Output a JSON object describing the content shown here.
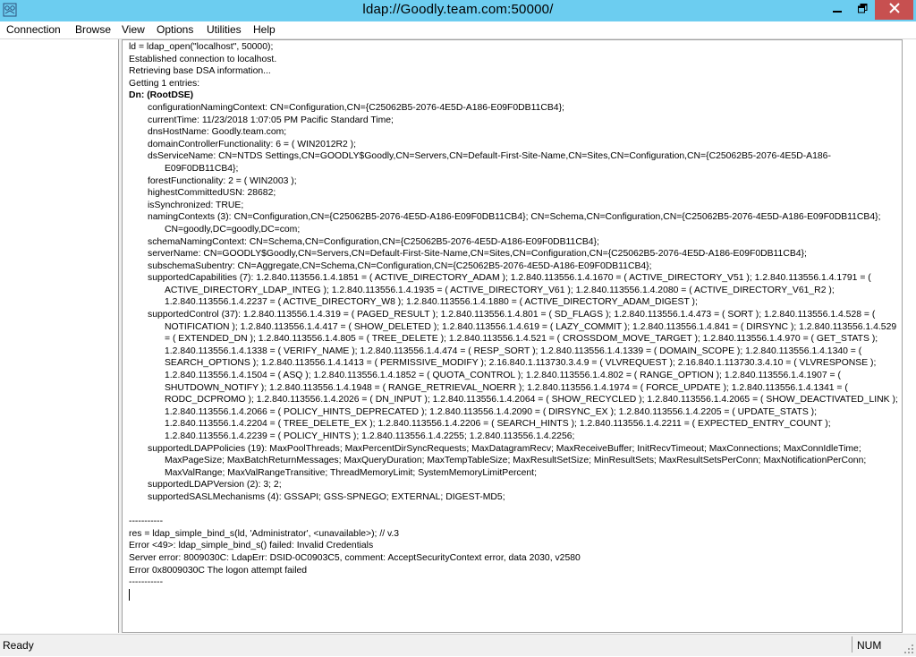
{
  "window": {
    "title": "ldap://Goodly.team.com:50000/",
    "app_icon": "ldp-app-icon",
    "controls": [
      "minimize-icon",
      "maximize-icon",
      "close-icon"
    ],
    "close_color": "#c75050",
    "titlebar_color": "#6ccdf0"
  },
  "menu": [
    "Connection",
    "Browse",
    "View",
    "Options",
    "Utilities",
    "Help"
  ],
  "output": {
    "lines": [
      {
        "text": "ld = ldap_open(\"localhost\", 50000);",
        "indent": 0
      },
      {
        "text": "Established connection to localhost.",
        "indent": 0
      },
      {
        "text": "Retrieving base DSA information...",
        "indent": 0
      },
      {
        "text": "Getting 1 entries:",
        "indent": 0
      },
      {
        "text": "Dn: (RootDSE)",
        "indent": 0,
        "bold": true
      },
      {
        "text": "configurationNamingContext: CN=Configuration,CN={C25062B5-2076-4E5D-A186-E09F0DB11CB4};",
        "indent": 1
      },
      {
        "text": "currentTime: 11/23/2018 1:07:05 PM Pacific Standard Time;",
        "indent": 1
      },
      {
        "text": "dnsHostName: Goodly.team.com;",
        "indent": 1
      },
      {
        "text": "domainControllerFunctionality: 6 = ( WIN2012R2 );",
        "indent": 1
      },
      {
        "text": "dsServiceName: CN=NTDS Settings,CN=GOODLY$Goodly,CN=Servers,CN=Default-First-Site-Name,CN=Sites,CN=Configuration,CN={C25062B5-2076-4E5D-A186-",
        "indent": 1
      },
      {
        "text": "E09F0DB11CB4};",
        "indent": 2
      },
      {
        "text": "forestFunctionality: 2 = ( WIN2003 );",
        "indent": 1
      },
      {
        "text": "highestCommittedUSN: 28682;",
        "indent": 1
      },
      {
        "text": "isSynchronized: TRUE;",
        "indent": 1
      },
      {
        "text": "namingContexts (3): CN=Configuration,CN={C25062B5-2076-4E5D-A186-E09F0DB11CB4}; CN=Schema,CN=Configuration,CN={C25062B5-2076-4E5D-A186-E09F0DB11CB4};",
        "indent": 1
      },
      {
        "text": "CN=goodly,DC=goodly,DC=com;",
        "indent": 2
      },
      {
        "text": "schemaNamingContext: CN=Schema,CN=Configuration,CN={C25062B5-2076-4E5D-A186-E09F0DB11CB4};",
        "indent": 1
      },
      {
        "text": "serverName: CN=GOODLY$Goodly,CN=Servers,CN=Default-First-Site-Name,CN=Sites,CN=Configuration,CN={C25062B5-2076-4E5D-A186-E09F0DB11CB4};",
        "indent": 1
      },
      {
        "text": "subschemaSubentry: CN=Aggregate,CN=Schema,CN=Configuration,CN={C25062B5-2076-4E5D-A186-E09F0DB11CB4};",
        "indent": 1
      },
      {
        "text": "supportedCapabilities (7): 1.2.840.113556.1.4.1851 = ( ACTIVE_DIRECTORY_ADAM ); 1.2.840.113556.1.4.1670 = ( ACTIVE_DIRECTORY_V51 ); 1.2.840.113556.1.4.1791 = (",
        "indent": 1
      },
      {
        "text": "ACTIVE_DIRECTORY_LDAP_INTEG ); 1.2.840.113556.1.4.1935 = ( ACTIVE_DIRECTORY_V61 ); 1.2.840.113556.1.4.2080 = ( ACTIVE_DIRECTORY_V61_R2 );",
        "indent": 2
      },
      {
        "text": "1.2.840.113556.1.4.2237 = ( ACTIVE_DIRECTORY_W8 ); 1.2.840.113556.1.4.1880 = ( ACTIVE_DIRECTORY_ADAM_DIGEST );",
        "indent": 2
      },
      {
        "text": "supportedControl (37): 1.2.840.113556.1.4.319 = ( PAGED_RESULT ); 1.2.840.113556.1.4.801 = ( SD_FLAGS ); 1.2.840.113556.1.4.473 = ( SORT ); 1.2.840.113556.1.4.528 = (",
        "indent": 1
      },
      {
        "text": "NOTIFICATION ); 1.2.840.113556.1.4.417 = ( SHOW_DELETED ); 1.2.840.113556.1.4.619 = ( LAZY_COMMIT ); 1.2.840.113556.1.4.841 = ( DIRSYNC ); 1.2.840.113556.1.4.529",
        "indent": 2
      },
      {
        "text": "= ( EXTENDED_DN ); 1.2.840.113556.1.4.805 = ( TREE_DELETE ); 1.2.840.113556.1.4.521 = ( CROSSDOM_MOVE_TARGET ); 1.2.840.113556.1.4.970 = ( GET_STATS );",
        "indent": 2
      },
      {
        "text": "1.2.840.113556.1.4.1338 = ( VERIFY_NAME ); 1.2.840.113556.1.4.474 = ( RESP_SORT ); 1.2.840.113556.1.4.1339 = ( DOMAIN_SCOPE ); 1.2.840.113556.1.4.1340 = (",
        "indent": 2
      },
      {
        "text": "SEARCH_OPTIONS ); 1.2.840.113556.1.4.1413 = ( PERMISSIVE_MODIFY ); 2.16.840.1.113730.3.4.9 = ( VLVREQUEST ); 2.16.840.1.113730.3.4.10 = ( VLVRESPONSE );",
        "indent": 2
      },
      {
        "text": "1.2.840.113556.1.4.1504 = ( ASQ ); 1.2.840.113556.1.4.1852 = ( QUOTA_CONTROL ); 1.2.840.113556.1.4.802 = ( RANGE_OPTION ); 1.2.840.113556.1.4.1907 = (",
        "indent": 2
      },
      {
        "text": "SHUTDOWN_NOTIFY ); 1.2.840.113556.1.4.1948 = ( RANGE_RETRIEVAL_NOERR ); 1.2.840.113556.1.4.1974 = ( FORCE_UPDATE ); 1.2.840.113556.1.4.1341 = (",
        "indent": 2
      },
      {
        "text": "RODC_DCPROMO ); 1.2.840.113556.1.4.2026 = ( DN_INPUT ); 1.2.840.113556.1.4.2064 = ( SHOW_RECYCLED ); 1.2.840.113556.1.4.2065 = ( SHOW_DEACTIVATED_LINK );",
        "indent": 2
      },
      {
        "text": "1.2.840.113556.1.4.2066 = ( POLICY_HINTS_DEPRECATED ); 1.2.840.113556.1.4.2090 = ( DIRSYNC_EX ); 1.2.840.113556.1.4.2205 = ( UPDATE_STATS );",
        "indent": 2
      },
      {
        "text": "1.2.840.113556.1.4.2204 = ( TREE_DELETE_EX ); 1.2.840.113556.1.4.2206 = ( SEARCH_HINTS ); 1.2.840.113556.1.4.2211 = ( EXPECTED_ENTRY_COUNT );",
        "indent": 2
      },
      {
        "text": "1.2.840.113556.1.4.2239 = ( POLICY_HINTS ); 1.2.840.113556.1.4.2255; 1.2.840.113556.1.4.2256;",
        "indent": 2
      },
      {
        "text": "supportedLDAPPolicies (19): MaxPoolThreads; MaxPercentDirSyncRequests; MaxDatagramRecv; MaxReceiveBuffer; InitRecvTimeout; MaxConnections; MaxConnIdleTime;",
        "indent": 1
      },
      {
        "text": "MaxPageSize; MaxBatchReturnMessages; MaxQueryDuration; MaxTempTableSize; MaxResultSetSize; MinResultSets; MaxResultSetsPerConn; MaxNotificationPerConn;",
        "indent": 2
      },
      {
        "text": "MaxValRange; MaxValRangeTransitive; ThreadMemoryLimit; SystemMemoryLimitPercent;",
        "indent": 2
      },
      {
        "text": "supportedLDAPVersion (2): 3; 2;",
        "indent": 1
      },
      {
        "text": "supportedSASLMechanisms (4): GSSAPI; GSS-SPNEGO; EXTERNAL; DIGEST-MD5;",
        "indent": 1
      },
      {
        "text": "",
        "indent": 0
      },
      {
        "text": "-----------",
        "indent": 0
      },
      {
        "text": "res = ldap_simple_bind_s(ld, 'Administrator', <unavailable>); // v.3",
        "indent": 0
      },
      {
        "text": "Error <49>: ldap_simple_bind_s() failed: Invalid Credentials",
        "indent": 0
      },
      {
        "text": "Server error: 8009030C: LdapErr: DSID-0C0903C5, comment: AcceptSecurityContext error, data 2030, v2580",
        "indent": 0
      },
      {
        "text": "Error 0x8009030C The logon attempt failed",
        "indent": 0
      },
      {
        "text": "-----------",
        "indent": 0
      }
    ]
  },
  "status": {
    "left": "Ready",
    "num": "NUM"
  }
}
